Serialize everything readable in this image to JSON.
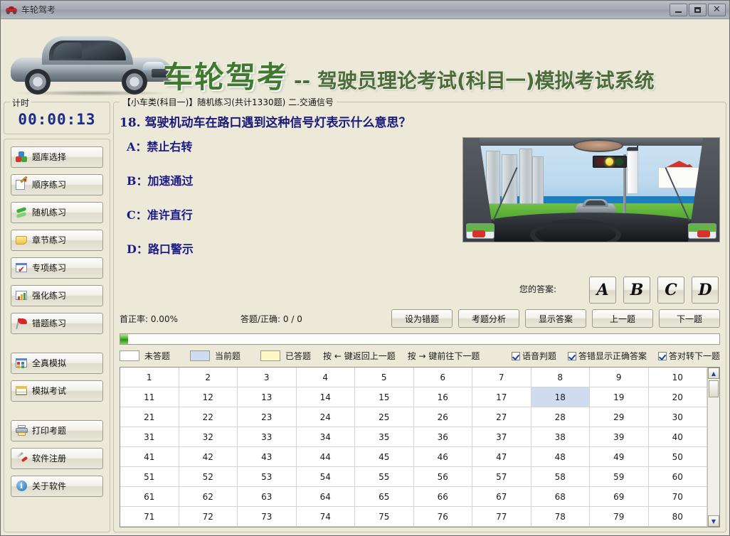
{
  "window": {
    "title": "车轮驾考",
    "icon": "car-icon",
    "buttons": {
      "minimize": "minimize-icon",
      "maximize": "maximize-icon",
      "close": "close-icon"
    }
  },
  "banner": {
    "brand": "车轮驾考",
    "subtitle": "-- 驾驶员理论考试(科目一)模拟考试系统"
  },
  "sidebar": {
    "timer": {
      "legend": "计时",
      "value": "00:00:13"
    },
    "buttons": [
      {
        "label": "题库选择",
        "icon": "cubes-icon"
      },
      {
        "label": "顺序练习",
        "icon": "pencil-icon"
      },
      {
        "label": "随机练习",
        "icon": "shuffle-icon"
      },
      {
        "label": "章节练习",
        "icon": "note-icon"
      },
      {
        "label": "专项练习",
        "icon": "checkmark-icon"
      },
      {
        "label": "强化练习",
        "icon": "chart-icon"
      },
      {
        "label": "错题练习",
        "icon": "flag-icon"
      },
      {
        "label": "全真模拟",
        "icon": "grid-icon"
      },
      {
        "label": "模拟考试",
        "icon": "calendar-icon"
      },
      {
        "label": "打印考题",
        "icon": "printer-icon"
      },
      {
        "label": "软件注册",
        "icon": "screwdriver-icon"
      },
      {
        "label": "关于软件",
        "icon": "info-icon"
      }
    ]
  },
  "main": {
    "breadcrumb": "【小车类(科目一)】随机练习(共计1330题) 二.交通信号",
    "question": {
      "number": "18.",
      "text": "驾驶机动车在路口遇到这种信号灯表示什么意思？",
      "full": "18. 驾驶机动车在路口遇到这种信号灯表示什么意思？",
      "options": [
        {
          "key": "A",
          "text": "A：禁止右转"
        },
        {
          "key": "B",
          "text": "B：加速通过"
        },
        {
          "key": "C",
          "text": "C：准许直行"
        },
        {
          "key": "D",
          "text": "D：路口警示"
        }
      ],
      "image_alt": "driver-view-traffic-light"
    },
    "answer": {
      "label": "您的答案:",
      "choices": [
        "A",
        "B",
        "C",
        "D"
      ]
    },
    "stats": {
      "first_rate": "首正率: 0.00%",
      "answered": "答题/正确: 0 / 0"
    },
    "actions": [
      {
        "label": "设为错题"
      },
      {
        "label": "考题分析"
      },
      {
        "label": "显示答案"
      },
      {
        "label": "上一题"
      },
      {
        "label": "下一题"
      }
    ],
    "progress": {
      "percent": 1.3
    },
    "legend": [
      {
        "label": "未答题",
        "swatch": "#ffffff"
      },
      {
        "label": "当前题",
        "swatch": "#cfdcf0"
      },
      {
        "label": "已答题",
        "swatch": "#fdf8c4"
      }
    ],
    "hints": [
      "按 ← 键返回上一题",
      "按 → 键前往下一题"
    ],
    "checkboxes": [
      {
        "label": "语音判题",
        "checked": true
      },
      {
        "label": "答错显示正确答案",
        "checked": true
      },
      {
        "label": "答对转下一题",
        "checked": true
      }
    ],
    "grid": {
      "columns": 10,
      "current": 18,
      "cells": [
        1,
        2,
        3,
        4,
        5,
        6,
        7,
        8,
        9,
        10,
        11,
        12,
        13,
        14,
        15,
        16,
        17,
        18,
        19,
        20,
        21,
        22,
        23,
        24,
        25,
        26,
        27,
        28,
        29,
        30,
        31,
        32,
        33,
        34,
        35,
        36,
        37,
        38,
        39,
        40,
        41,
        42,
        43,
        44,
        45,
        46,
        47,
        48,
        49,
        50,
        51,
        52,
        53,
        54,
        55,
        56,
        57,
        58,
        59,
        60,
        61,
        62,
        63,
        64,
        65,
        66,
        67,
        68,
        69,
        70,
        71,
        72,
        73,
        74,
        75,
        76,
        77,
        78,
        79,
        80
      ]
    },
    "scrollbar": {
      "up": "▲",
      "down": "▼"
    }
  },
  "colors": {
    "window_bg": "#ece9d8",
    "brand_green": "#3f7a2e",
    "question_blue": "#1a1a7a",
    "timer_blue": "#1a2b8c",
    "current_cell": "#cfdcf0",
    "answered_cell": "#fdf8c4"
  }
}
